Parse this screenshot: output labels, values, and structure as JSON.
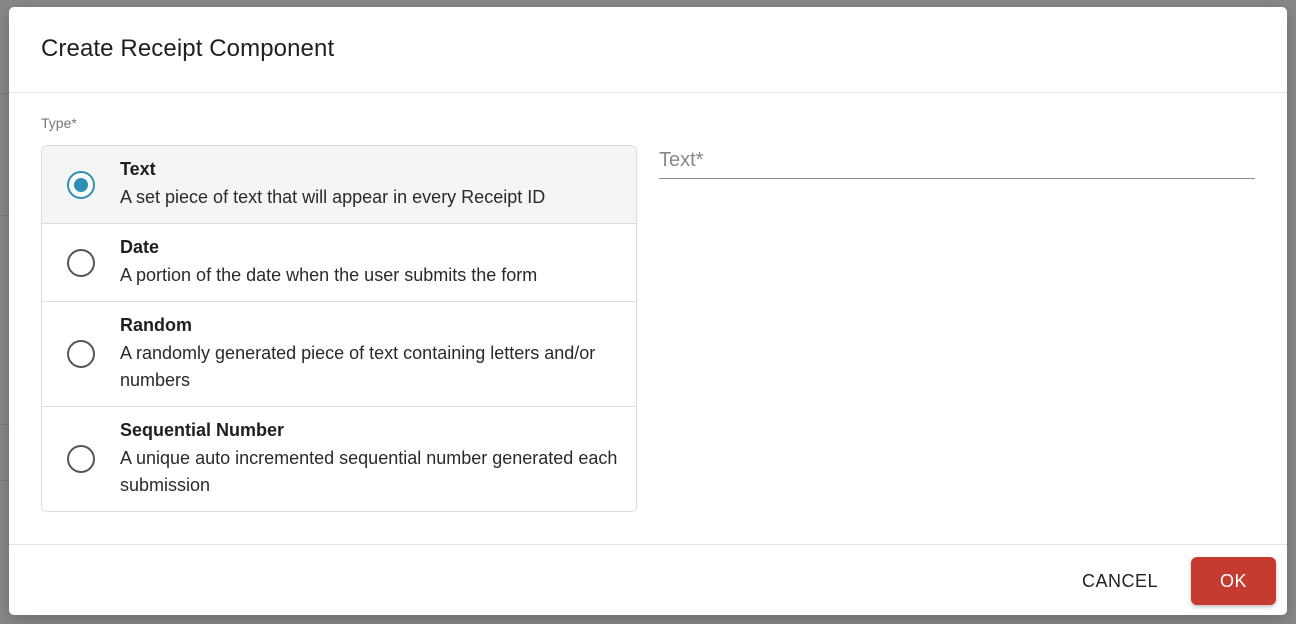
{
  "dialog": {
    "title": "Create Receipt Component",
    "type_label": "Type*",
    "options": [
      {
        "title": "Text",
        "description": "A set piece of text that will appear in every Receipt ID",
        "selected": true
      },
      {
        "title": "Date",
        "description": "A portion of the date when the user submits the form",
        "selected": false
      },
      {
        "title": "Random",
        "description": "A randomly generated piece of text containing letters and/or numbers",
        "selected": false
      },
      {
        "title": "Sequential Number",
        "description": "A unique auto incremented sequential number generated each submission",
        "selected": false
      }
    ],
    "text_field": {
      "placeholder": "Text*",
      "value": ""
    },
    "cancel_label": "CANCEL",
    "ok_label": "OK"
  },
  "colors": {
    "accent": "#2f8fb5",
    "ok_button": "#c53b2f"
  }
}
